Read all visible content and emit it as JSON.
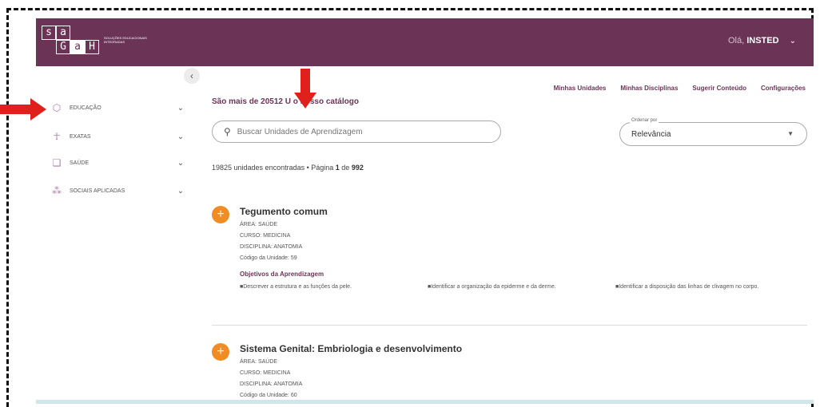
{
  "logo": {
    "letters": [
      "s",
      "a",
      "",
      "",
      "G",
      "a",
      "H"
    ],
    "tagline": "SOLUÇÕES EDUCACIONAIS INTEGRADAS"
  },
  "header": {
    "greeting": "Olá,",
    "user": "INSTED",
    "chevron": "⌄"
  },
  "sidebar": {
    "collapse": "‹",
    "items": [
      {
        "label": "Educação",
        "icon": "graduation-cap-icon",
        "glyph": "⬡",
        "color": "#b07aa6"
      },
      {
        "label": "Exatas",
        "icon": "person-icon",
        "glyph": "☥",
        "color": "#b07aa6"
      },
      {
        "label": "Saúde",
        "icon": "chat-icon",
        "glyph": "❑",
        "color": "#b07aa6"
      },
      {
        "label": "Sociais Aplicadas",
        "icon": "group-icon",
        "glyph": "⁂",
        "color": "#b07aa6"
      }
    ]
  },
  "toplinks": [
    "Minhas Unidades",
    "Minhas Disciplinas",
    "Sugerir Conteúdo",
    "Configurações"
  ],
  "catalog": "São mais de 20512 U   o nosso catálogo",
  "search": {
    "placeholder": "Buscar Unidades de Aprendizagem"
  },
  "order": {
    "label": "Ordenar por",
    "value": "Relevância"
  },
  "results": {
    "prefix": "19825 unidades encontradas • Página ",
    "page": "1",
    "mid": " de ",
    "total": "992"
  },
  "units": [
    {
      "title": "Tegumento comum",
      "area": "ÁREA: SAÚDE",
      "curso": "CURSO: MEDICINA",
      "disciplina": "DISCIPLINA: ANATOMIA",
      "codigo": "Código da Unidade: 59",
      "objetivos_label": "Objetivos da Aprendizagem",
      "objetivos": [
        "■Descrever a estrutura e as funções da pele.",
        "■Identificar a organização da epiderme e da derme.",
        "■Identificar a disposição das linhas de clivagem no corpo."
      ]
    },
    {
      "title": "Sistema Genital: Embriologia e desenvolvimento",
      "area": "ÁREA: SAÚDE",
      "curso": "CURSO: MEDICINA",
      "disciplina": "DISCIPLINA: ANATOMIA",
      "codigo": "Código da Unidade: 60"
    }
  ],
  "colors": {
    "brand": "#6b3456",
    "accent": "#f08c23",
    "arrow": "#e0211b"
  }
}
